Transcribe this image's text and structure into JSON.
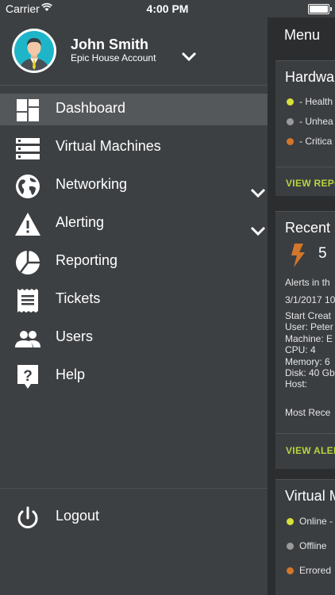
{
  "status_bar": {
    "carrier": "Carrier",
    "time": "4:00 PM"
  },
  "user": {
    "name": "John Smith",
    "account": "Epic House Account"
  },
  "nav": {
    "items": [
      {
        "label": "Dashboard",
        "icon": "dashboard-icon",
        "active": true
      },
      {
        "label": "Virtual Machines",
        "icon": "server-icon"
      },
      {
        "label": "Networking",
        "icon": "globe-icon",
        "expandable": true
      },
      {
        "label": "Alerting",
        "icon": "warning-icon",
        "expandable": true
      },
      {
        "label": "Reporting",
        "icon": "pie-chart-icon"
      },
      {
        "label": "Tickets",
        "icon": "receipt-icon"
      },
      {
        "label": "Users",
        "icon": "people-icon"
      },
      {
        "label": "Help",
        "icon": "help-icon"
      }
    ],
    "logout": "Logout"
  },
  "peek": {
    "menu_title": "Menu",
    "hardware": {
      "title": "Hardwa",
      "rows": [
        "- Health",
        "- Unhea",
        "- Critica"
      ],
      "colors": [
        "#d6e03a",
        "#9a9a9a",
        "#d2772a"
      ],
      "link": "VIEW REPO"
    },
    "recent": {
      "title": "Recent",
      "count": "5",
      "alerts_label": "Alerts in th",
      "date": "3/1/2017 10",
      "details": [
        "Start Creat",
        "User: Peter",
        "Machine: E",
        "CPU: 4",
        "Memory: 6",
        "Disk: 40 Gb",
        "Host:"
      ],
      "most_recent": "Most Rece",
      "link": "VIEW ALER"
    },
    "virtual": {
      "title": "Virtual M",
      "rows": [
        "Online -",
        "Offline",
        "Errored"
      ],
      "colors": [
        "#d6e03a",
        "#9a9a9a",
        "#d2772a"
      ]
    }
  },
  "colors": {
    "accent": "#b9d340",
    "drawer_bg": "#3d4043",
    "active_bg": "#55585b",
    "avatar_bg": "#1fb5c9"
  }
}
